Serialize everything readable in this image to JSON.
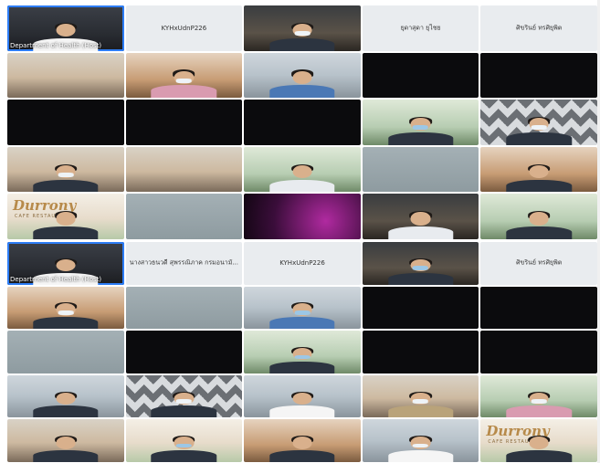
{
  "panel1": {
    "tiles": [
      {
        "kind": "host",
        "label": "Department of Health (Host)"
      },
      {
        "kind": "name",
        "label": "KYHxUdnP226"
      },
      {
        "kind": "video",
        "style": "dark-office"
      },
      {
        "kind": "name",
        "label": "ยุดาสุดา ยุไชย"
      },
      {
        "kind": "name",
        "label": "ศิขรินย์ ทรศิยุพิต"
      },
      {
        "kind": "video",
        "style": "room"
      },
      {
        "kind": "video",
        "style": "wood"
      },
      {
        "kind": "video",
        "style": "office"
      },
      {
        "kind": "video",
        "style": "black"
      },
      {
        "kind": "video",
        "style": "black"
      },
      {
        "kind": "video",
        "style": "black"
      },
      {
        "kind": "video",
        "style": "black"
      },
      {
        "kind": "video",
        "style": "black"
      },
      {
        "kind": "video",
        "style": "green"
      },
      {
        "kind": "video",
        "style": "geo"
      },
      {
        "kind": "video",
        "style": "room"
      },
      {
        "kind": "video",
        "style": "room"
      },
      {
        "kind": "video",
        "style": "green"
      },
      {
        "kind": "video",
        "style": "blurgray"
      },
      {
        "kind": "video",
        "style": "wood"
      },
      {
        "kind": "cafe",
        "title": "Durrony",
        "subtitle": "CAFE RESTAURANT"
      },
      {
        "kind": "video",
        "style": "blurgray"
      },
      {
        "kind": "video",
        "style": "purple"
      },
      {
        "kind": "video",
        "style": "dark-office"
      },
      {
        "kind": "video",
        "style": "green"
      }
    ]
  },
  "panel2": {
    "tiles": [
      {
        "kind": "host",
        "label": "Department of Health (Host)"
      },
      {
        "kind": "name",
        "label": "นางสาวธนวดี สุพรรณิภาค กรมอนามั..."
      },
      {
        "kind": "name",
        "label": "KYHxUdnP226"
      },
      {
        "kind": "video",
        "style": "dark-office"
      },
      {
        "kind": "name",
        "label": "ศิขรินย์ ทรศิยุพิต"
      },
      {
        "kind": "video",
        "style": "wood"
      },
      {
        "kind": "video",
        "style": "blurgray"
      },
      {
        "kind": "video",
        "style": "office"
      },
      {
        "kind": "video",
        "style": "black"
      },
      {
        "kind": "video",
        "style": "black"
      },
      {
        "kind": "video",
        "style": "blurgray"
      },
      {
        "kind": "video",
        "style": "black"
      },
      {
        "kind": "video",
        "style": "green"
      },
      {
        "kind": "video",
        "style": "black"
      },
      {
        "kind": "video",
        "style": "black"
      },
      {
        "kind": "video",
        "style": "office"
      },
      {
        "kind": "video",
        "style": "geo"
      },
      {
        "kind": "video",
        "style": "office"
      },
      {
        "kind": "video",
        "style": "room"
      },
      {
        "kind": "video",
        "style": "green"
      },
      {
        "kind": "video",
        "style": "room"
      },
      {
        "kind": "video",
        "style": "cafe"
      },
      {
        "kind": "video",
        "style": "wood"
      },
      {
        "kind": "video",
        "style": "office"
      },
      {
        "kind": "cafe",
        "title": "Durrony",
        "subtitle": "CAFE RESTAURANT"
      }
    ]
  }
}
